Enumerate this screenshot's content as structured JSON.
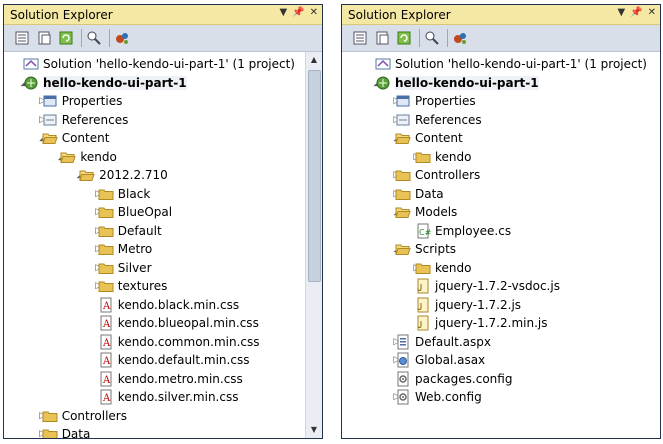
{
  "left": {
    "title": "Solution Explorer",
    "rows": [
      {
        "label": "Solution 'hello-kendo-ui-part-1' (1 project)",
        "icon": "solution",
        "arrow": "",
        "depth": 0
      },
      {
        "label": "hello-kendo-ui-part-1",
        "icon": "project",
        "arrow": "open",
        "depth": 0,
        "selected": true
      },
      {
        "label": "Properties",
        "icon": "properties",
        "arrow": "closed",
        "depth": 1
      },
      {
        "label": "References",
        "icon": "references",
        "arrow": "closed",
        "depth": 1
      },
      {
        "label": "Content",
        "icon": "folder-open",
        "arrow": "open",
        "depth": 1
      },
      {
        "label": "kendo",
        "icon": "folder-open",
        "arrow": "open",
        "depth": 2
      },
      {
        "label": "2012.2.710",
        "icon": "folder-open",
        "arrow": "open",
        "depth": 3
      },
      {
        "label": "Black",
        "icon": "folder",
        "arrow": "closed",
        "depth": 4
      },
      {
        "label": "BlueOpal",
        "icon": "folder",
        "arrow": "closed",
        "depth": 4
      },
      {
        "label": "Default",
        "icon": "folder",
        "arrow": "closed",
        "depth": 4
      },
      {
        "label": "Metro",
        "icon": "folder",
        "arrow": "closed",
        "depth": 4
      },
      {
        "label": "Silver",
        "icon": "folder",
        "arrow": "closed",
        "depth": 4
      },
      {
        "label": "textures",
        "icon": "folder",
        "arrow": "closed",
        "depth": 4
      },
      {
        "label": "kendo.black.min.css",
        "icon": "css",
        "arrow": "",
        "depth": 4
      },
      {
        "label": "kendo.blueopal.min.css",
        "icon": "css",
        "arrow": "",
        "depth": 4
      },
      {
        "label": "kendo.common.min.css",
        "icon": "css",
        "arrow": "",
        "depth": 4
      },
      {
        "label": "kendo.default.min.css",
        "icon": "css",
        "arrow": "",
        "depth": 4
      },
      {
        "label": "kendo.metro.min.css",
        "icon": "css",
        "arrow": "",
        "depth": 4
      },
      {
        "label": "kendo.silver.min.css",
        "icon": "css",
        "arrow": "",
        "depth": 4
      },
      {
        "label": "Controllers",
        "icon": "folder",
        "arrow": "closed",
        "depth": 1
      },
      {
        "label": "Data",
        "icon": "folder",
        "arrow": "closed",
        "depth": 1
      }
    ]
  },
  "right": {
    "title": "Solution Explorer",
    "rows": [
      {
        "label": "Solution 'hello-kendo-ui-part-1' (1 project)",
        "icon": "solution",
        "arrow": "",
        "depth": 0
      },
      {
        "label": "hello-kendo-ui-part-1",
        "icon": "project",
        "arrow": "open",
        "depth": 0,
        "selected": true
      },
      {
        "label": "Properties",
        "icon": "properties",
        "arrow": "closed",
        "depth": 1
      },
      {
        "label": "References",
        "icon": "references",
        "arrow": "closed",
        "depth": 1
      },
      {
        "label": "Content",
        "icon": "folder-open",
        "arrow": "open",
        "depth": 1
      },
      {
        "label": "kendo",
        "icon": "folder",
        "arrow": "closed",
        "depth": 2
      },
      {
        "label": "Controllers",
        "icon": "folder",
        "arrow": "closed",
        "depth": 1
      },
      {
        "label": "Data",
        "icon": "folder",
        "arrow": "closed",
        "depth": 1
      },
      {
        "label": "Models",
        "icon": "folder-open",
        "arrow": "open",
        "depth": 1
      },
      {
        "label": "Employee.cs",
        "icon": "cs",
        "arrow": "",
        "depth": 2
      },
      {
        "label": "Scripts",
        "icon": "folder-open",
        "arrow": "open",
        "depth": 1
      },
      {
        "label": "kendo",
        "icon": "folder",
        "arrow": "closed",
        "depth": 2
      },
      {
        "label": "jquery-1.7.2-vsdoc.js",
        "icon": "js",
        "arrow": "",
        "depth": 2
      },
      {
        "label": "jquery-1.7.2.js",
        "icon": "js",
        "arrow": "",
        "depth": 2
      },
      {
        "label": "jquery-1.7.2.min.js",
        "icon": "js",
        "arrow": "",
        "depth": 2
      },
      {
        "label": "Default.aspx",
        "icon": "aspx",
        "arrow": "closed",
        "depth": 1
      },
      {
        "label": "Global.asax",
        "icon": "asax",
        "arrow": "closed",
        "depth": 1
      },
      {
        "label": "packages.config",
        "icon": "config",
        "arrow": "",
        "depth": 1
      },
      {
        "label": "Web.config",
        "icon": "config",
        "arrow": "closed",
        "depth": 1
      }
    ]
  },
  "colors": {
    "panel_border": "#2b3c58",
    "titlebar": "#f4e8a4",
    "toolbar": "#d8dfe9",
    "folder": "#e8c254"
  }
}
